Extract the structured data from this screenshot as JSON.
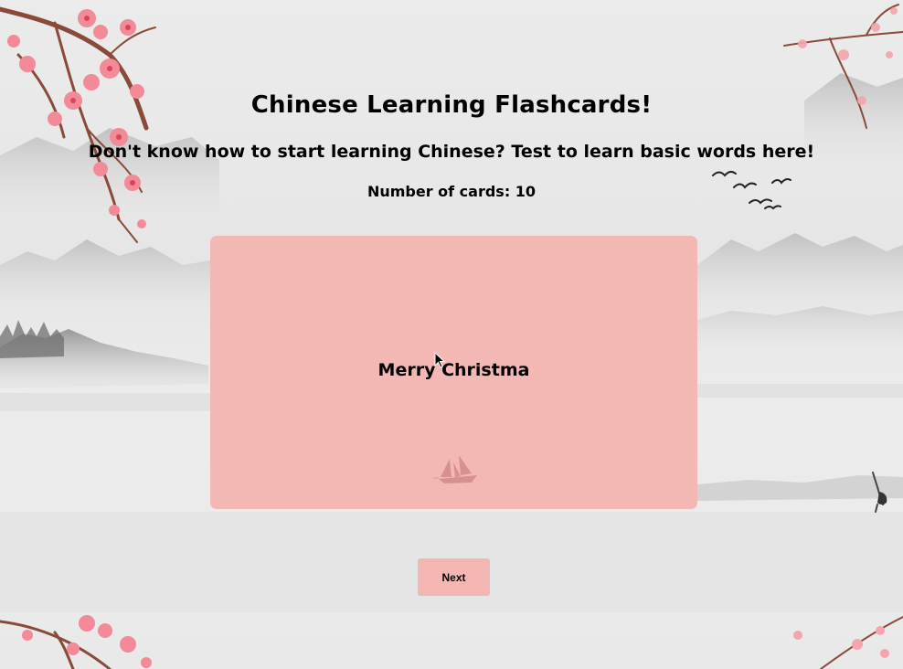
{
  "app": {
    "title": "Chinese Learning Flashcards!",
    "subtitle": "Don't know how to start learning Chinese? Test to learn basic words here!",
    "card_count_label": "Number of cards: 10"
  },
  "flashcard": {
    "text": "Merry Christma"
  },
  "controls": {
    "next_label": "Next"
  },
  "colors": {
    "card": "#f4b8b4",
    "button": "#f4b6b2",
    "blossom": "#f28a98",
    "branch": "#8a4a3a",
    "background": "#e9e9e9"
  },
  "decorations": {
    "branch_icon": "cherry-blossom-branch-icon",
    "birds_icon": "flying-birds-icon",
    "boat_icon": "sailboat-icon",
    "crane_icon": "crane-bird-icon",
    "cursor_icon": "mouse-pointer-icon"
  }
}
